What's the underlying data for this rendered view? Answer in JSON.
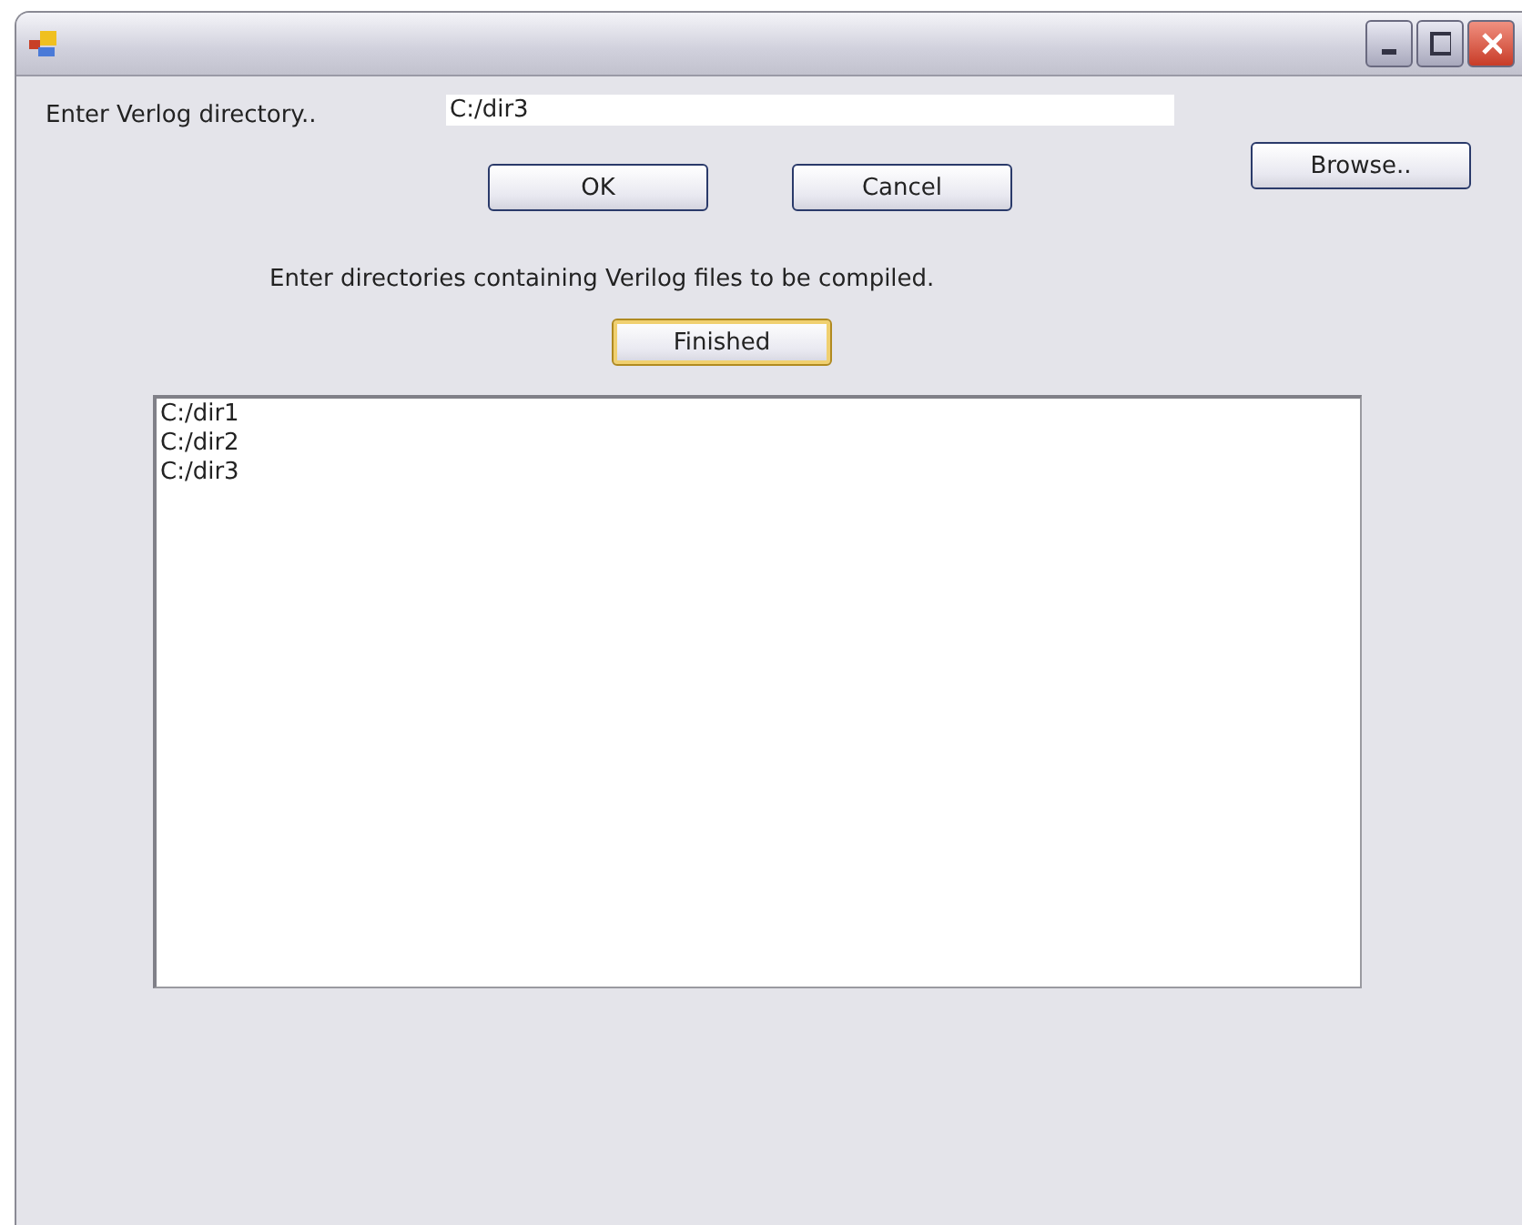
{
  "directory_label": "Enter Verlog directory..",
  "directory_field": {
    "value": "C:/dir3"
  },
  "browse_button": "Browse..",
  "ok_button": "OK",
  "cancel_button": "Cancel",
  "instruction": "Enter directories containing Verilog files to be compiled.",
  "finished_button": {
    "label": "Finished",
    "focused": true
  },
  "directories": [
    "C:/dir1",
    "C:/dir2",
    "C:/dir3"
  ]
}
